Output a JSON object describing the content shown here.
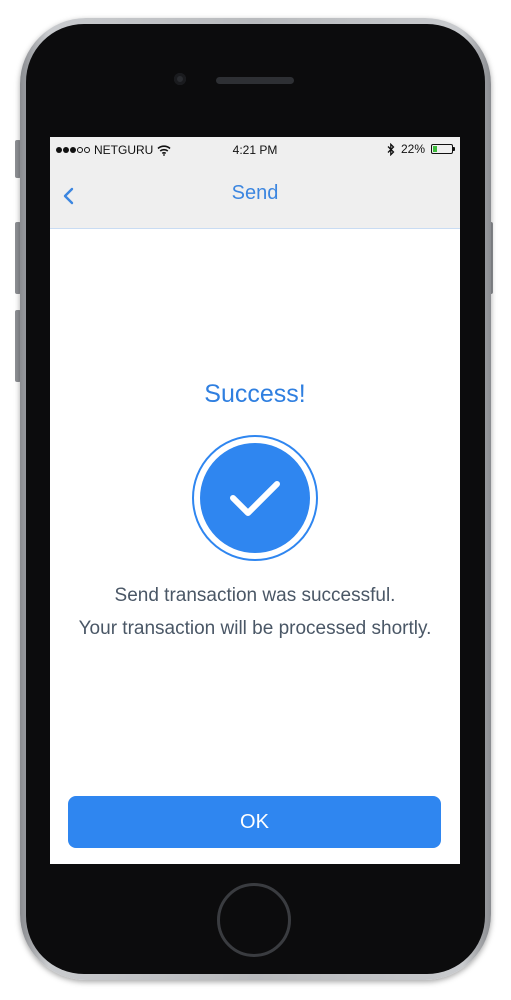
{
  "status_bar": {
    "carrier": "NETGURU",
    "time": "4:21 PM",
    "battery": "22%",
    "battery_level": 0.22,
    "signal_bars": 3,
    "signal_total": 5,
    "icons": [
      "wifi-icon",
      "bluetooth-icon",
      "battery-icon"
    ]
  },
  "navbar": {
    "title": "Send",
    "back_icon": "chevron-left-icon"
  },
  "content": {
    "heading": "Success!",
    "icon": "checkmark-icon",
    "message_line1": "Send transaction was successful.",
    "message_line2": "Your transaction will be processed shortly."
  },
  "actions": {
    "ok_label": "OK"
  },
  "colors": {
    "accent": "#2f86f0",
    "heading": "#2f7fe0",
    "text": "#4a5766",
    "bar_bg": "#efefef"
  }
}
